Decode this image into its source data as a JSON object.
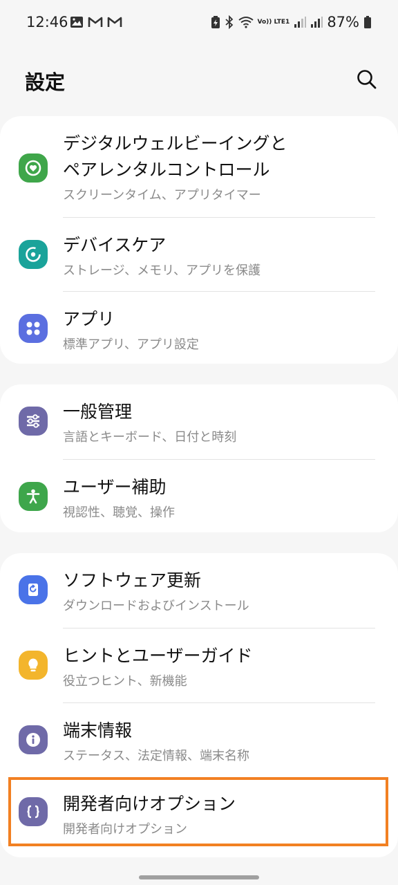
{
  "status_bar": {
    "time": "12:46",
    "battery_percent": "87%",
    "left_icons": [
      "gallery-icon",
      "gmail-icon",
      "gmail-icon"
    ],
    "right_icons": [
      "battery-saver-icon",
      "bluetooth-icon",
      "wifi-icon",
      "volte-icon",
      "signal-icon",
      "signal-icon",
      "battery-icon"
    ],
    "volte_label": "Vo)) LTE1"
  },
  "header": {
    "title": "設定",
    "search_icon": "search-icon"
  },
  "groups": [
    {
      "items": [
        {
          "title_line1": "デジタルウェルビーイングと",
          "title_line2": "ペアレンタルコントロール",
          "subtitle": "スクリーンタイム、アプリタイマー",
          "icon": "digital-wellbeing-icon",
          "color": "#3fa64a"
        },
        {
          "title": "デバイスケア",
          "subtitle": "ストレージ、メモリ、アプリを保護",
          "icon": "device-care-icon",
          "color": "#1aa39a"
        },
        {
          "title": "アプリ",
          "subtitle": "標準アプリ、アプリ設定",
          "icon": "apps-icon",
          "color": "#5b6fe0"
        }
      ]
    },
    {
      "items": [
        {
          "title": "一般管理",
          "subtitle": "言語とキーボード、日付と時刻",
          "icon": "general-management-icon",
          "color": "#6f6aa8"
        },
        {
          "title": "ユーザー補助",
          "subtitle": "視認性、聴覚、操作",
          "icon": "accessibility-icon",
          "color": "#3ea64b"
        }
      ]
    },
    {
      "items": [
        {
          "title": "ソフトウェア更新",
          "subtitle": "ダウンロードおよびインストール",
          "icon": "software-update-icon",
          "color": "#4a73e8"
        },
        {
          "title": "ヒントとユーザーガイド",
          "subtitle": "役立つヒント、新機能",
          "icon": "tips-icon",
          "color": "#f3b52c"
        },
        {
          "title": "端末情報",
          "subtitle": "ステータス、法定情報、端末名称",
          "icon": "about-phone-icon",
          "color": "#6f6aa8"
        },
        {
          "title": "開発者向けオプション",
          "subtitle": "開発者向けオプション",
          "icon": "developer-options-icon",
          "color": "#6f6aa8"
        }
      ]
    }
  ]
}
